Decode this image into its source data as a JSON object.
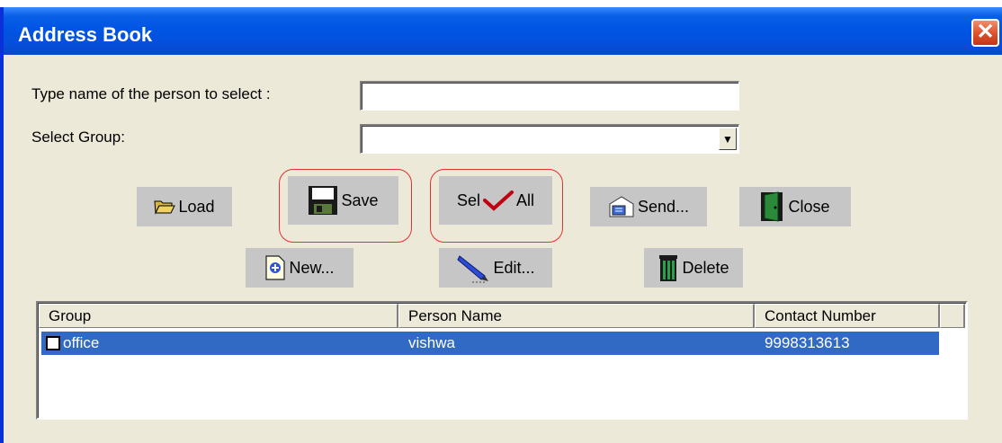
{
  "window": {
    "title": "Address Book",
    "close_symbol": "✕"
  },
  "form": {
    "name_label": "Type name of the person to select :",
    "name_value": "",
    "group_label": "Select Group:",
    "group_value": ""
  },
  "toolbar": {
    "load": "Load",
    "save": "Save",
    "sel_prefix": "Sel",
    "sel_suffix": "All",
    "send": "Send...",
    "close": "Close",
    "new": "New...",
    "edit": "Edit...",
    "delete": "Delete"
  },
  "list": {
    "columns": [
      "Group",
      "Person Name",
      "Contact Number"
    ],
    "rows": [
      {
        "group": "office",
        "person": "vishwa",
        "contact": "9998313613",
        "checked": false,
        "selected": true
      }
    ]
  },
  "colors": {
    "selection": "#316ac5",
    "highlight_outline": "#e03030",
    "titlebar": "#0054e3"
  }
}
